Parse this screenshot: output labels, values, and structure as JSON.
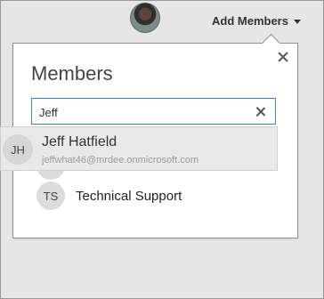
{
  "header": {
    "add_members_label": "Add Members"
  },
  "panel": {
    "title": "Members",
    "search_value": "Jeff",
    "members": [
      {
        "initials": "TS",
        "name": "Technical Support"
      }
    ]
  },
  "suggestion": {
    "initials": "JH",
    "name": "Jeff Hatfield",
    "email": "jeffwhat46@mrdee.onmicrosoft.com"
  }
}
